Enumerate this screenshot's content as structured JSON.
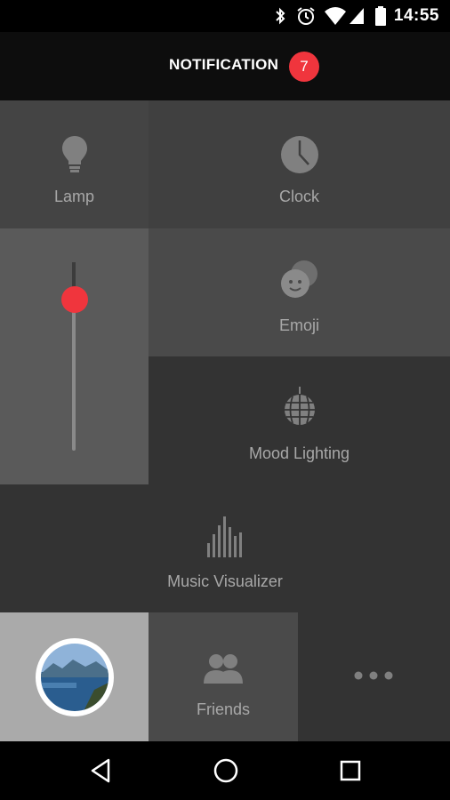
{
  "status_bar": {
    "time": "14:55"
  },
  "header": {
    "title": "NOTIFICATION",
    "badge_count": "7"
  },
  "tiles": {
    "lamp": {
      "label": "Lamp",
      "icon": "lightbulb-icon"
    },
    "clock": {
      "label": "Clock",
      "icon": "clock-icon"
    },
    "emoji": {
      "label": "Emoji",
      "icon": "emoji-icon"
    },
    "mood_lighting": {
      "label": "Mood Lighting",
      "icon": "disco-ball-icon"
    },
    "music_visualizer": {
      "label": "Music Visualizer",
      "icon": "equalizer-bars-icon"
    },
    "friends": {
      "label": "Friends",
      "icon": "people-icon"
    },
    "more": {
      "icon": "more-dots-icon"
    }
  },
  "slider": {
    "level": 0.8
  },
  "colors": {
    "accent": "#f0353d",
    "tile_dark": "#333333",
    "tile_mid": "#444444",
    "tile_light": "#555555"
  }
}
